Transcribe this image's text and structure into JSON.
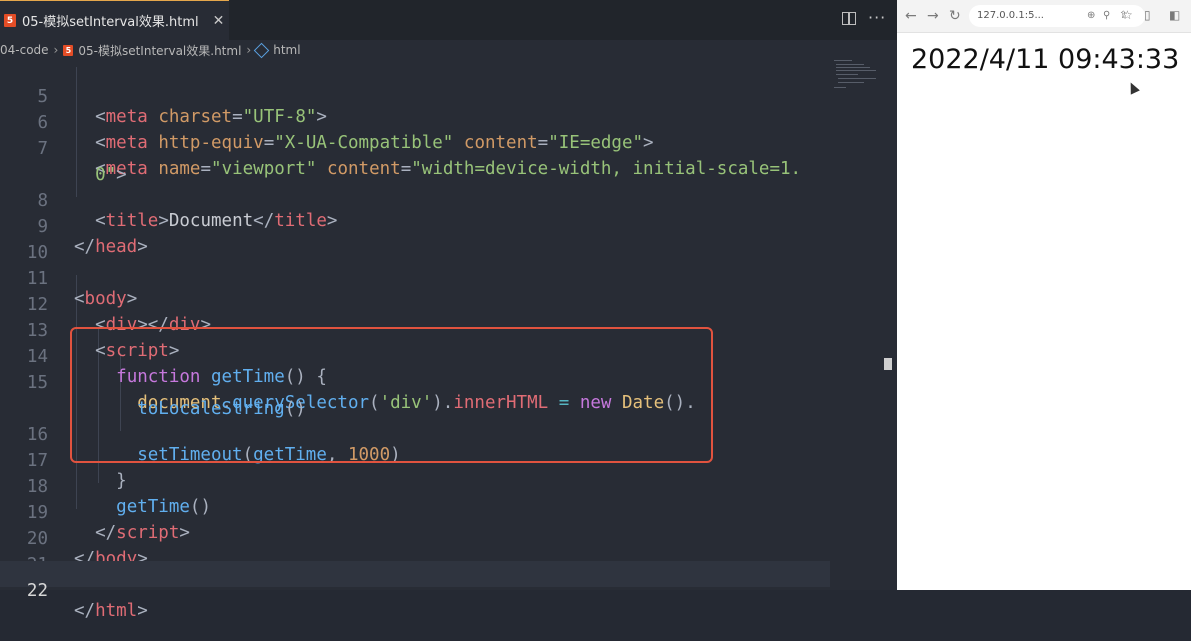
{
  "editor": {
    "tab_icon": "5",
    "tab_title": "05-模拟setInterval效果.html",
    "tab_close": "✕",
    "breadcrumb": {
      "folder": "04-code",
      "file": "05-模拟setInterval效果.html",
      "node": "html"
    },
    "lines": {
      "l5": "5",
      "l6": "6",
      "l7": "7",
      "l8": "8",
      "l9": "9",
      "l10": "10",
      "l11": "11",
      "l12": "12",
      "l13": "13",
      "l14": "14",
      "l15": "15",
      "l16": "16",
      "l17": "17",
      "l18": "18",
      "l19": "19",
      "l20": "20",
      "l21": "21",
      "l22": "22"
    },
    "tokens": {
      "meta": "meta",
      "charset": "charset",
      "utf8": "\"UTF-8\"",
      "http_equiv": "http-equiv",
      "x_ua": "\"X-UA-Compatible\"",
      "content": "content",
      "ie_edge": "\"IE=edge\"",
      "name": "name",
      "viewport": "\"viewport\"",
      "viewport_val_1": "\"width=device-width, initial-scale=1.",
      "viewport_val_2": "0\"",
      "title": "title",
      "document_text": "Document",
      "head": "head",
      "body": "body",
      "div": "div",
      "script": "script",
      "function_kw": "function",
      "get_time": "getTime",
      "parens_open": "() {",
      "document_obj": "document",
      "query_selector": "querySelector",
      "div_str": "'div'",
      "inner_html": "innerHTML",
      "equals": "=",
      "new_kw": "new",
      "date": "Date",
      "to_locale": "toLocaleString",
      "set_timeout": "setTimeout",
      "ms": "1000",
      "close_brace": "}",
      "html": "html"
    }
  },
  "browser": {
    "url": "127.0.0.1:5...",
    "displayed_time": "2022/4/11 09:43:33"
  }
}
